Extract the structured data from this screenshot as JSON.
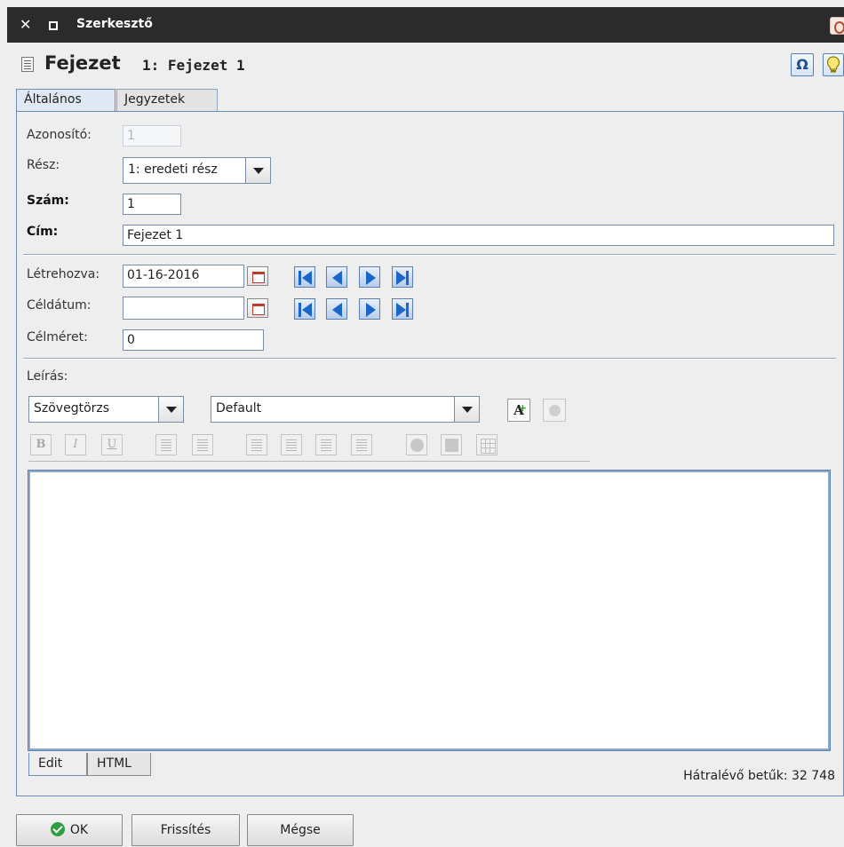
{
  "window": {
    "title": "Szerkesztő"
  },
  "header": {
    "title": "Fejezet",
    "subtitle": "1: Fejezet 1",
    "omega_glyph": "Ω",
    "hint_glyph": "💡"
  },
  "tabs": [
    {
      "label": "Általános",
      "active": true
    },
    {
      "label": "Jegyzetek",
      "active": false
    }
  ],
  "form": {
    "id_label": "Azonosító:",
    "id_value": "1",
    "part_label": "Rész:",
    "part_value": "1: eredeti rész",
    "number_label": "Szám:",
    "number_value": "1",
    "title_label": "Cím:",
    "title_value": "Fejezet 1",
    "created_label": "Létrehozva:",
    "created_value": "01-16-2016",
    "target_date_label": "Céldátum:",
    "target_date_value": "",
    "target_size_label": "Célméret:",
    "target_size_value": "0",
    "description_label": "Leírás:"
  },
  "toolbar": {
    "style_value": "Szövegtörzs",
    "font_value": "Default",
    "bold": "B",
    "italic": "I",
    "underline": "U",
    "font_plus": "A"
  },
  "editor": {
    "content": "",
    "tabs": [
      {
        "label": "Edit",
        "active": true
      },
      {
        "label": "HTML",
        "active": false
      }
    ],
    "remaining_text": "Hátralévő betűk: 32 748"
  },
  "buttons": {
    "ok": "OK",
    "refresh": "Frissítés",
    "cancel": "Mégse"
  },
  "colors": {
    "accent_blue": "#1b66c9",
    "title_bar": "#2b2b2b",
    "ok_green": "#2e9e3f"
  }
}
